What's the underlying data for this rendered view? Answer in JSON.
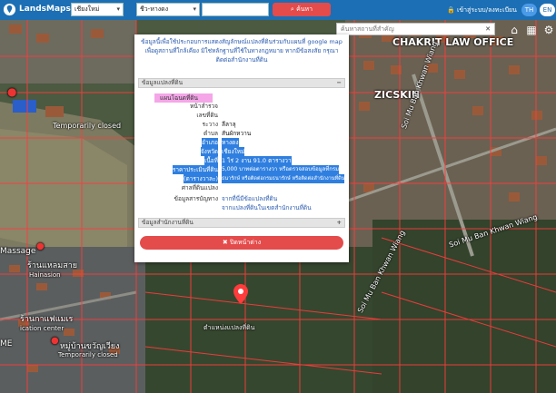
{
  "header": {
    "brand": "LandsMaps",
    "province": "เชียงใหม่",
    "district": "ชีว-หางดง",
    "search_button": "ค้นหา",
    "login": "เข้าสู่ระบบ/ลงทะเบียน",
    "lang_th": "TH",
    "lang_en": "EN"
  },
  "map": {
    "poi_search_placeholder": "ค้นหาสถานที่สำคัญ",
    "labels": {
      "law_office": "CHAKRIT LAW OFFICE",
      "zicskin": "ZICSKIN",
      "temp_closed_1": "Temporarily closed",
      "soi_1": "Soi Mu Ban Khwan Wiang",
      "soi_2": "Soi Mu Ban Khwan Wiang",
      "soi_3": "Soi Mu Ban Khwan Wiang",
      "massage": "Massage",
      "rankanmassage": "ร้านแหลมสาย",
      "hainan": "Hainasion",
      "kuen": "ร้านกาแฟแมเร",
      "cation": "ication center",
      "me": "ME",
      "temp_closed_2": "Temporarily closed",
      "ban_khwan": "หมู่บ้านขวัญเวียง",
      "pin_label": "ตำแหน่งแปลงที่ดิน"
    }
  },
  "popup": {
    "notice": "ข้อมูลนี้เพื่อใช้ประกอบการแสดงสัญลักษณ์แปลงที่ดินร่วมกับแผนที่ google map เพื่อดูสถานที่ใกล้เคียง มิใช่หลักฐานที่ใช้ในทางกฎหมาย หากมีข้อสงสัย กรุณาติดต่อสำนักงานที่ดิน",
    "section_land": "ข้อมูลแปลงที่ดิน",
    "section_office": "ข้อมูลสำนักงานที่ดิน",
    "toggle_minus": "−",
    "toggle_plus": "+",
    "deed_label": "แผนโฉนดที่ดิน",
    "rows": [
      {
        "label": "หน้าสำรวจ",
        "value": ""
      },
      {
        "label": "เลขที่ดิน",
        "value": ""
      },
      {
        "label": "ระวาง",
        "value": "ลีลาลุ"
      },
      {
        "label": "ตำบล",
        "value": "สันผักหวาน"
      },
      {
        "label": "อำเภอ",
        "value": "หางดง"
      },
      {
        "label": "จังหวัด",
        "value": "เชียงใหม่"
      },
      {
        "label": "เนื้อที่",
        "value": "1 ไร่ 2 งาน 91.0 ตารางวา"
      },
      {
        "label": "ราคาประเมินที่ดิน",
        "value": "5,000 บาทต่อตารางวา หรือตรวจสอบข้อมูลที่กรม"
      },
      {
        "label": "(ตารางวาละ)",
        "value": "ธนารักษ์ หรือติดต่อกรมธนารักษ์ หรือติดต่อสำนักงานที่ดิน"
      },
      {
        "label": "ศาลที่ดินแปลง",
        "value": ""
      },
      {
        "label": "ข้อมูลสารบัญทาง",
        "value": "จากที่นี่มีข้อแปลงที่ดิน"
      },
      {
        "label": "",
        "value": "จากแปลงที่ดินในเขตสำนักงานที่ดิน"
      }
    ],
    "close_button": "ปิดหน้าต่าง"
  },
  "colors": {
    "topbar": "#1c6fb4",
    "search_red": "#e44b4b",
    "parcel_red": "#ff3b3b",
    "highlight_blue": "#2f7fe0",
    "deed_pink": "#f4a6e8"
  }
}
